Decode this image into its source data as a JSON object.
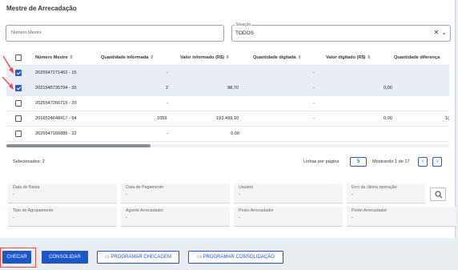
{
  "title": "Mestre de Arrecadação",
  "filters": {
    "numero_placeholder": "Número Mestre",
    "situacao_legend": "Situação",
    "situacao_value": "TODOS"
  },
  "table": {
    "headers": [
      "Número Mestre",
      "Quantidade informada",
      "Valor informado (R$)",
      "Quantidade digitada",
      "Valor digitado (R$)",
      "Quantidade diferença"
    ],
    "rows": [
      {
        "checked": true,
        "numero": "2025547271462 - 15",
        "qtd_inf": "-",
        "valor_inf": "",
        "qtd_dig": "-",
        "valor_dig": "",
        "qtd_dif": ""
      },
      {
        "checked": true,
        "numero": "2021545735704 - 35",
        "qtd_inf": "2",
        "valor_inf": "98,70",
        "qtd_dig": "-",
        "valor_dig": "0,00",
        "qtd_dif": ""
      },
      {
        "checked": false,
        "numero": "2025547266715 - 20",
        "qtd_inf": "-",
        "valor_inf": "",
        "qtd_dig": "-",
        "valor_dig": "",
        "qtd_dif": ""
      },
      {
        "checked": false,
        "numero": "2016534648417 - 94",
        "qtd_inf": "1059",
        "valor_inf": "193.499,10",
        "qtd_dig": "-",
        "valor_dig": "0,00",
        "qtd_dif": "1("
      },
      {
        "checked": false,
        "numero": "2025547166885 - 32",
        "qtd_inf": "-",
        "valor_inf": "0,00",
        "qtd_dig": "",
        "valor_dig": "",
        "qtd_dif": ""
      }
    ]
  },
  "footer": {
    "selecionados": "Selecionados: 2",
    "linhas_label": "Linhas por página",
    "linhas_value": "5",
    "mostrando": "Mostrando 1 de 17"
  },
  "info_fields": [
    {
      "label": "Data de Baixa",
      "value": "-"
    },
    {
      "label": "Data de Pagamento",
      "value": "-"
    },
    {
      "label": "Usuário",
      "value": "-"
    },
    {
      "label": "Erro da última operação",
      "value": "-"
    },
    {
      "label": "Tipo de Agrupamento",
      "value": "-"
    },
    {
      "label": "Agente Arrecadador",
      "value": "-"
    },
    {
      "label": "Posto Arrecadador",
      "value": "-"
    },
    {
      "label": "Ponto Arrecadador",
      "value": "-"
    }
  ],
  "buttons": {
    "checar": "CHECAR",
    "consolidar": "CONSOLIDAR",
    "programar_checagem": "PROGRAMAR CHECAGEM",
    "programar_consolidacao": "PROGRAMAR CONSOLIDAÇÃO"
  },
  "colors": {
    "primary": "#1e56c7",
    "checkbox_checked": "#2d5bb8",
    "annotation_red": "#e04b4b"
  }
}
